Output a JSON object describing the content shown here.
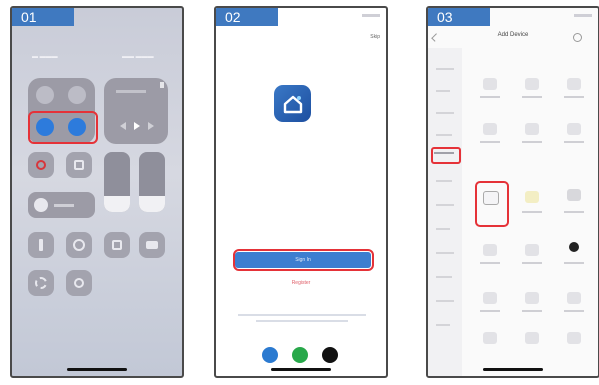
{
  "steps": [
    {
      "number": "01"
    },
    {
      "number": "02",
      "skip_label": "Skip",
      "sign_in_label": "Sign In",
      "register_label": "Register"
    },
    {
      "number": "03",
      "header_title": "Add Device"
    }
  ],
  "colors": {
    "step_tag": "#3f79c0",
    "highlight": "#e53238",
    "toggle_active": "#2d7bdc",
    "brand": "#3d7ed0"
  },
  "icons": {
    "phone1": [
      "airplane-icon",
      "cellular-icon",
      "wifi-icon",
      "bluetooth-icon",
      "rotation-lock-icon",
      "screen-mirror-icon",
      "night-mode-icon",
      "flashlight-icon",
      "timer-icon",
      "calculator-icon",
      "camera-icon",
      "settings-icon",
      "add-icon"
    ],
    "phone2": [
      "app-logo-icon",
      "social-login-icon-blue",
      "social-login-icon-green",
      "social-login-icon-black"
    ],
    "phone3": [
      "back-icon",
      "scan-icon",
      "device-icon"
    ]
  }
}
